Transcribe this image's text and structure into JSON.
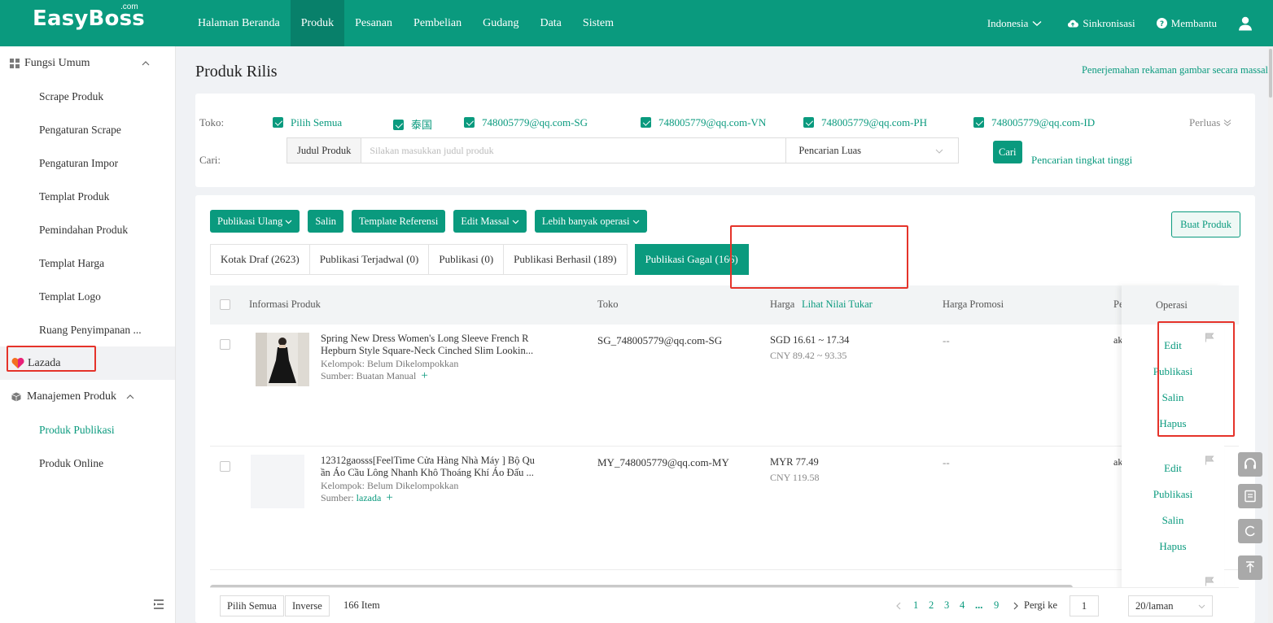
{
  "brand": {
    "logo": "EasyBoss",
    "logo_sup": ".com"
  },
  "nav": [
    "Halaman Beranda",
    "Produk",
    "Pesanan",
    "Pembelian",
    "Gudang",
    "Data",
    "Sistem"
  ],
  "header_right": {
    "region": "Indonesia",
    "sync": "Sinkronisasi",
    "help": "Membantu"
  },
  "sidebar": {
    "group1": "Fungsi Umum",
    "items": [
      "Scrape Produk",
      "Pengaturan Scrape",
      "Pengaturan Impor",
      "Templat Produk",
      "Pemindahan Produk",
      "Templat Harga",
      "Templat Logo",
      "Ruang Penyimpanan ..."
    ],
    "platform": "Lazada",
    "group2": "Manajemen Produk",
    "sub_items": [
      "Produk Publikasi",
      "Produk Online"
    ]
  },
  "page": {
    "title": "Produk Rilis",
    "mass_link": "Penerjemahan rekaman gambar secara massal"
  },
  "filter": {
    "store_label": "Toko:",
    "stores": [
      "Pilih Semua",
      "泰国",
      "748005779@qq.com-SG",
      "748005779@qq.com-VN",
      "748005779@qq.com-PH",
      "748005779@qq.com-ID"
    ],
    "expand": "Perluas",
    "search_label": "Cari:",
    "field": "Judul Produk",
    "placeholder": "Silakan masukkan judul produk",
    "scope": "Pencarian Luas",
    "search_btn": "Cari",
    "advanced": "Pencarian tingkat tinggi"
  },
  "toolbar": {
    "republish": "Publikasi Ulang",
    "copy": "Salin",
    "template_ref": "Template Referensi",
    "bulk_edit": "Edit Massal",
    "more_ops": "Lebih banyak operasi",
    "create": "Buat Produk"
  },
  "tabs": [
    "Kotak Draf (2623)",
    "Publikasi Terjadwal (0)",
    "Publikasi (0)",
    "Publikasi Berhasil (189)",
    "Publikasi Gagal (166)"
  ],
  "table": {
    "headers": {
      "info": "Informasi Produk",
      "store": "Toko",
      "price": "Harga",
      "exchange": "Lihat Nilai Tukar",
      "promo": "Harga Promosi",
      "partial": "Per",
      "ops": "Operasi"
    },
    "rows": [
      {
        "name_line1": "Spring New Dress Women's Long Sleeve French R",
        "name_line2": "Hepburn Style Square-Neck Cinched Slim Lookin...",
        "group_label": "Kelompok:",
        "group": "Belum Dikelompokkan",
        "source_label": "Sumber:",
        "source": "Buatan Manual",
        "store": "SG_748005779@qq.com-SG",
        "price1": "SGD 16.61 ~ 17.34",
        "price2": "CNY 89.42 ~ 93.35",
        "promo": "--",
        "partial": "aku"
      },
      {
        "name_line1": "12312gaosss[FeelTime Cửa Hàng Nhà Máy ] Bộ Qu",
        "name_line2": "ần Áo Cầu Lông Nhanh Khô Thoáng Khí Áo Đấu ...",
        "group_label": "Kelompok:",
        "group": "Belum Dikelompokkan",
        "source_label": "Sumber:",
        "source": "lazada",
        "store": "MY_748005779@qq.com-MY",
        "price1": "MYR 77.49",
        "price2": "CNY 119.58",
        "promo": "--",
        "partial": "aku"
      }
    ],
    "ops": [
      "Edit",
      "Publikasi",
      "Salin",
      "Hapus"
    ]
  },
  "pager": {
    "select_all": "Pilih Semua",
    "inverse": "Inverse",
    "count": "166 Item",
    "pages": [
      "1",
      "2",
      "3",
      "4",
      "...",
      "9"
    ],
    "goto": "Pergi ke",
    "goto_value": "1",
    "per_page": "20/laman"
  },
  "colors": {
    "brand": "#0a9a7e",
    "highlight": "#e5332a"
  }
}
